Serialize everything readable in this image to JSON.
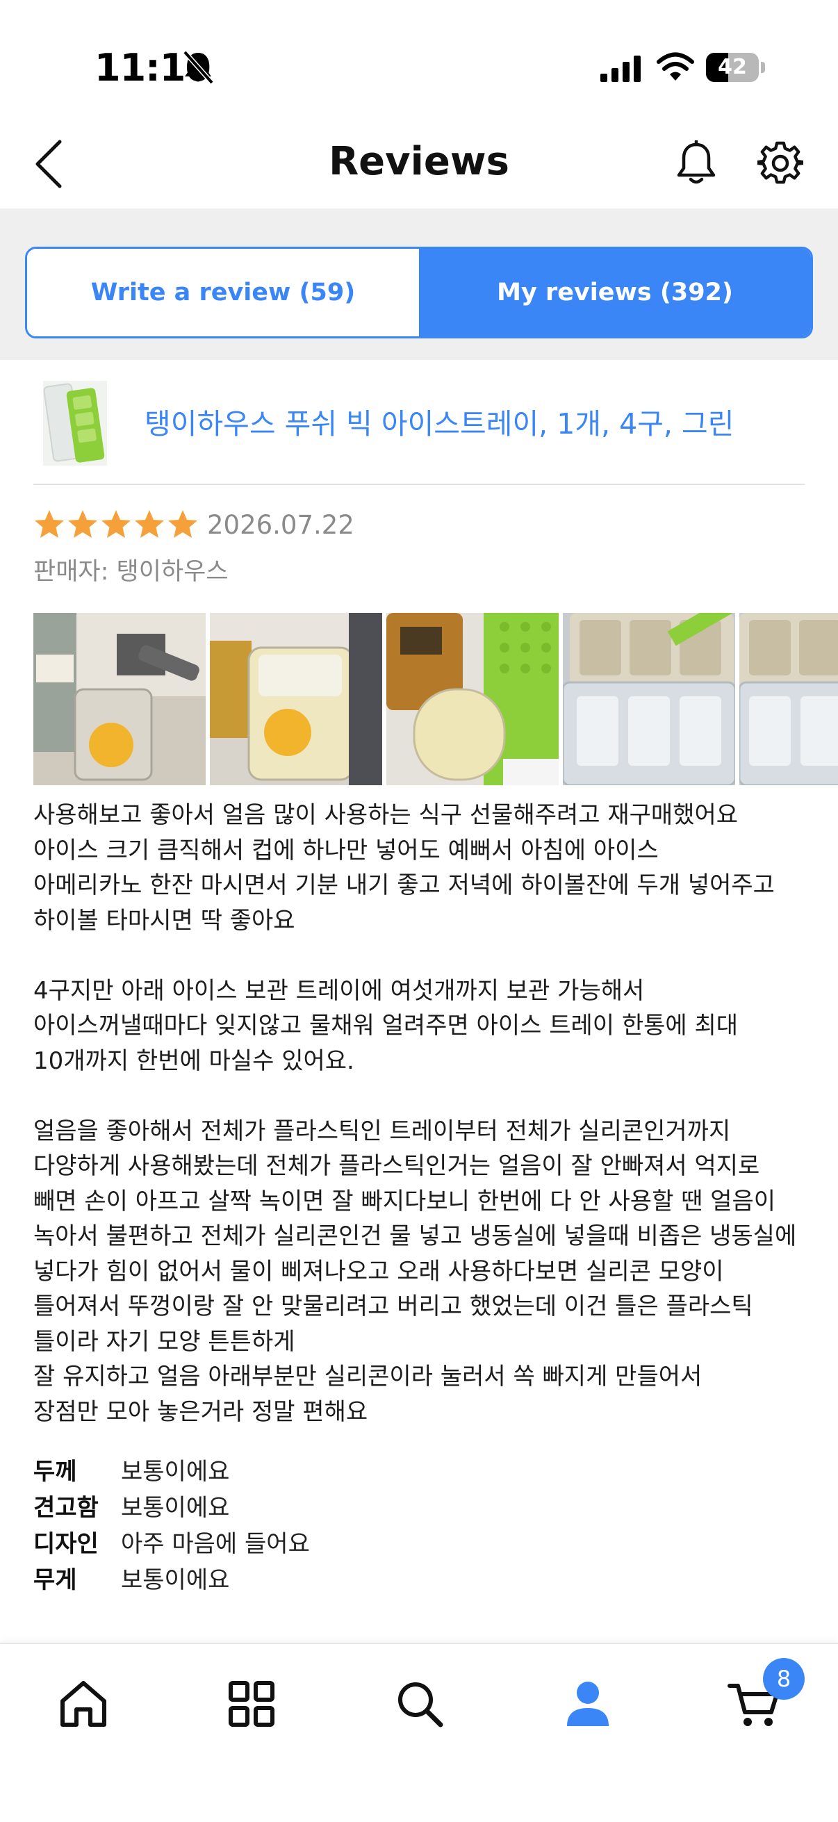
{
  "status_bar": {
    "time": "11:10",
    "battery_level": "42",
    "battery_fraction": 0.42,
    "icons": [
      "bell-slash-icon",
      "cellular-signal-icon",
      "wifi-icon",
      "battery-icon"
    ]
  },
  "header": {
    "title": "Reviews",
    "back_icon": "chevron-left-icon",
    "notification_icon": "bell-icon",
    "settings_icon": "gear-icon"
  },
  "tabs": {
    "write_review": "Write a review (59)",
    "my_reviews": "My reviews (392)",
    "active": "my_reviews"
  },
  "review": {
    "product_name": "탱이하우스 푸쉬 빅 아이스트레이, 1개, 4구, 그린",
    "rating": 5,
    "max_rating": 5,
    "date": "2026.07.22",
    "seller": "판매자: 탱이하우스",
    "photo_count_visible": 5,
    "body": "사용해보고 좋아서 얼음 많이 사용하는 식구 선물해주려고 재구매했어요\n아이스 크기 큼직해서 컵에 하나만 넣어도 예뻐서 아침에 아이스\n아메리카노 한잔 마시면서 기분 내기 좋고 저녁에 하이볼잔에 두개 넣어주고 하이볼 타마시면 딱 좋아요\n\n4구지만 아래 아이스 보관 트레이에 여섯개까지 보관 가능해서 아이스꺼낼때마다 잊지않고 물채워 얼려주면 아이스 트레이 한통에 최대 10개까지 한번에 마실수 있어요.\n\n얼음을 좋아해서 전체가 플라스틱인 트레이부터 전체가 실리콘인거까지 다양하게 사용해봤는데 전체가 플라스틱인거는 얼음이 잘 안빠져서 억지로 빼면 손이 아프고 살짝 녹이면 잘 빠지다보니 한번에 다 안 사용할 땐 얼음이 녹아서 불편하고 전체가 실리콘인건 물 넣고 냉동실에 넣을때 비좁은 냉동실에 넣다가 힘이 없어서 물이 삐져나오고 오래 사용하다보면 실리콘 모양이 틀어져서 뚜껑이랑 잘 안 맞물리려고 버리고 했었는데 이건 틀은 플라스틱 틀이라 자기 모양 튼튼하게\n잘 유지하고 얼음 아래부분만 실리콘이라 눌러서 쏙 빠지게 만들어서\n장점만 모아 놓은거라 정말 편해요",
    "attributes": [
      {
        "key": "두께",
        "value": "보통이에요"
      },
      {
        "key": "견고함",
        "value": "보통이에요"
      },
      {
        "key": "디자인",
        "value": "아주 마음에 들어요"
      },
      {
        "key": "무게",
        "value": "보통이에요"
      }
    ]
  },
  "bottom_nav": {
    "items": [
      "home-icon",
      "categories-grid-icon",
      "search-icon",
      "profile-icon",
      "cart-icon"
    ],
    "active": "profile-icon",
    "cart_badge": "8"
  },
  "colors": {
    "accent": "#3a86f6",
    "star": "#f5a03a",
    "muted_text": "#8a8a8a",
    "tab_band": "#efefef"
  }
}
